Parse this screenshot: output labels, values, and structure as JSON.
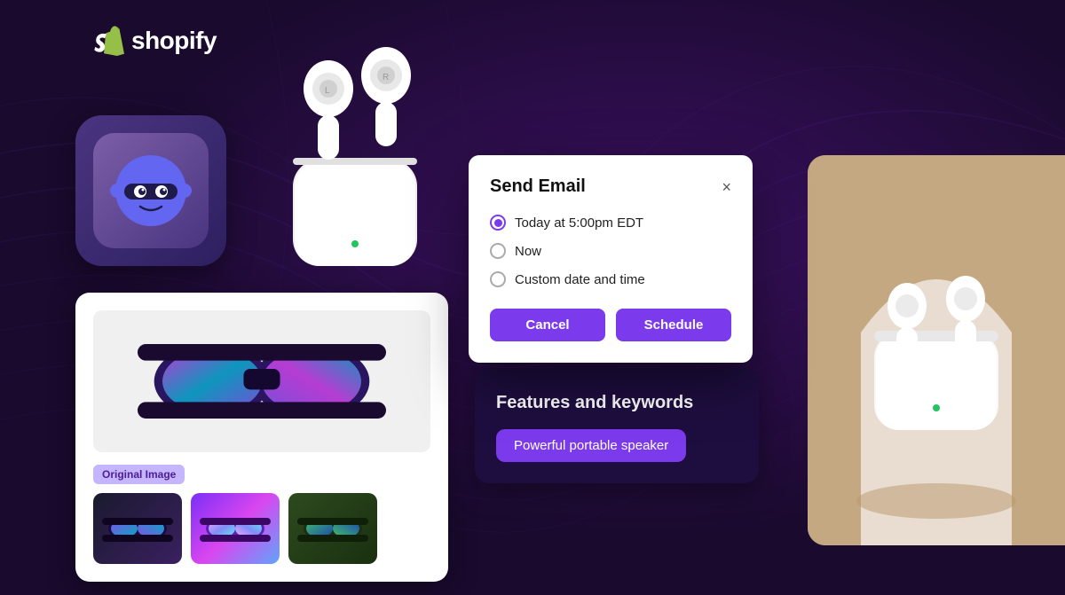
{
  "app": {
    "logo_text": "shopify",
    "background_color": "#1a0a2e"
  },
  "dialog": {
    "title": "Send Email",
    "close_label": "×",
    "options": [
      {
        "id": "today",
        "label": "Today at 5:00pm EDT",
        "selected": true
      },
      {
        "id": "now",
        "label": "Now",
        "selected": false
      },
      {
        "id": "custom",
        "label": "Custom date and time",
        "selected": false
      }
    ],
    "cancel_label": "Cancel",
    "schedule_label": "Schedule"
  },
  "image_editor": {
    "original_image_label": "Original Image",
    "thumbnails": [
      "thumb-dark",
      "thumb-colorful",
      "thumb-forest"
    ]
  },
  "features_card": {
    "title": "Features and keywords",
    "keyword": "Powerful portable speaker"
  }
}
